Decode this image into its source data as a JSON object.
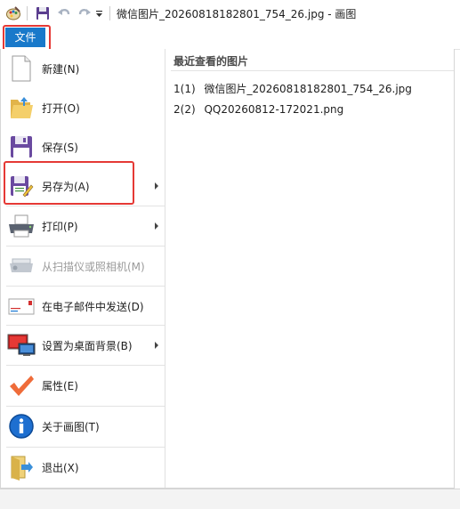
{
  "title": {
    "text": "微信图片_20260818182801_754_26.jpg - 画图"
  },
  "quick_access": {
    "app_icon": "paint-palette-icon",
    "save_icon": "save-disk-icon",
    "undo_icon": "undo-icon",
    "redo_icon": "redo-icon",
    "customize_icon": "dropdown-arrow-icon"
  },
  "file_tab": {
    "label": "文件"
  },
  "menu": {
    "items": [
      {
        "label": "新建(N)",
        "icon": "new-document-icon",
        "submenu": false,
        "enabled": true
      },
      {
        "label": "打开(O)",
        "icon": "open-folder-icon",
        "submenu": false,
        "enabled": true
      },
      {
        "label": "保存(S)",
        "icon": "save-disk-icon",
        "submenu": false,
        "enabled": true
      },
      {
        "label": "另存为(A)",
        "icon": "save-as-icon",
        "submenu": true,
        "enabled": true
      },
      {
        "label": "打印(P)",
        "icon": "printer-icon",
        "submenu": true,
        "enabled": true
      },
      {
        "label": "从扫描仪或照相机(M)",
        "icon": "scanner-icon",
        "submenu": false,
        "enabled": false
      },
      {
        "label": "在电子邮件中发送(D)",
        "icon": "email-icon",
        "submenu": false,
        "enabled": true
      },
      {
        "label": "设置为桌面背景(B)",
        "icon": "desktop-background-icon",
        "submenu": true,
        "enabled": true
      },
      {
        "label": "属性(E)",
        "icon": "checkmark-icon",
        "submenu": false,
        "enabled": true
      },
      {
        "label": "关于画图(T)",
        "icon": "info-icon",
        "submenu": false,
        "enabled": true
      },
      {
        "label": "退出(X)",
        "icon": "exit-icon",
        "submenu": false,
        "enabled": true
      }
    ]
  },
  "recent": {
    "title": "最近查看的图片",
    "items": [
      {
        "index": "1(1)",
        "name": "微信图片_20260818182801_754_26.jpg"
      },
      {
        "index": "2(2)",
        "name": "QQ20260812-172021.png"
      }
    ]
  },
  "colors": {
    "file_tab": "#1979ca",
    "highlight_box": "#e53935"
  }
}
